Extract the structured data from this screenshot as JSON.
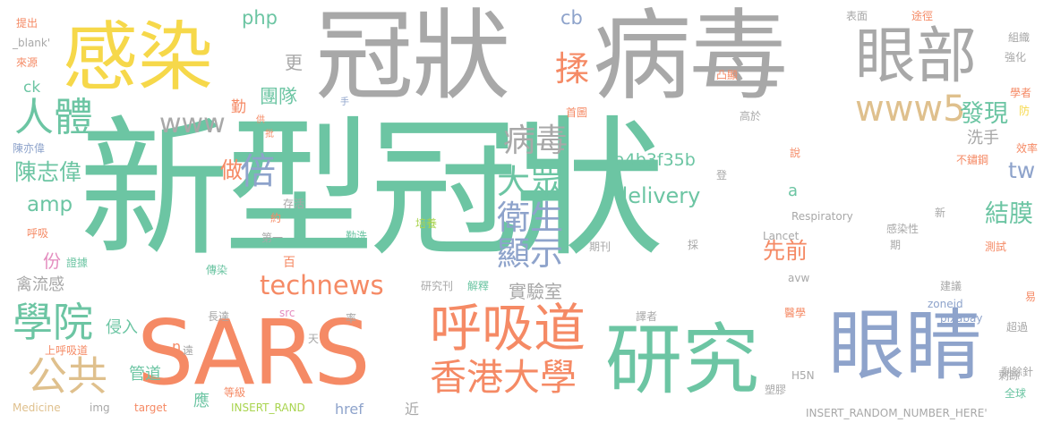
{
  "palette": {
    "green": "#6cc5a3",
    "gray": "#a8a8a8",
    "orange": "#f58a65",
    "blue": "#8ea3cb",
    "yellow": "#f6d84a",
    "pink": "#e48dbf",
    "lime": "#a9d44f",
    "tan": "#dfc08d"
  },
  "words": [
    {
      "text": "新型冠狀",
      "color": "green",
      "size": 160
    },
    {
      "text": "冠狀",
      "color": "gray",
      "size": 108
    },
    {
      "text": "病毒",
      "color": "gray",
      "size": 108
    },
    {
      "text": "感染",
      "color": "yellow",
      "size": 82
    },
    {
      "text": "SARS",
      "color": "orange",
      "size": 96
    },
    {
      "text": "研究",
      "color": "green",
      "size": 84
    },
    {
      "text": "眼睛",
      "color": "blue",
      "size": 84
    },
    {
      "text": "眼部",
      "color": "gray",
      "size": 66
    },
    {
      "text": "呼吸道",
      "color": "orange",
      "size": 56
    },
    {
      "text": "香港大學",
      "color": "orange",
      "size": 40
    },
    {
      "text": "人體",
      "color": "green",
      "size": 42
    },
    {
      "text": "學院",
      "color": "green",
      "size": 44
    },
    {
      "text": "公共",
      "color": "tan",
      "size": 44
    },
    {
      "text": "www5",
      "color": "tan",
      "size": 38
    },
    {
      "text": "www",
      "color": "gray",
      "size": 30
    },
    {
      "text": "technews",
      "color": "orange",
      "size": 28
    },
    {
      "text": "delivery",
      "color": "green",
      "size": 24
    },
    {
      "text": "a4b3f35b",
      "color": "green",
      "size": 19
    },
    {
      "text": "病毒",
      "color": "gray",
      "size": 34
    },
    {
      "text": "大眾",
      "color": "green",
      "size": 36
    },
    {
      "text": "衛生",
      "color": "blue",
      "size": 36
    },
    {
      "text": "顯示",
      "color": "blue",
      "size": 36
    },
    {
      "text": "實驗室",
      "color": "gray",
      "size": 20
    },
    {
      "text": "倍",
      "color": "blue",
      "size": 38
    },
    {
      "text": "揉",
      "color": "orange",
      "size": 36
    },
    {
      "text": "發現",
      "color": "green",
      "size": 26
    },
    {
      "text": "結膜",
      "color": "green",
      "size": 26
    },
    {
      "text": "先前",
      "color": "orange",
      "size": 24
    },
    {
      "text": "tw",
      "color": "blue",
      "size": 24
    },
    {
      "text": "陳志偉",
      "color": "green",
      "size": 24
    },
    {
      "text": "amp",
      "color": "green",
      "size": 22
    },
    {
      "text": "做",
      "color": "orange",
      "size": 24
    },
    {
      "text": "團隊",
      "color": "green",
      "size": 20
    },
    {
      "text": "php",
      "color": "green",
      "size": 20
    },
    {
      "text": "cb",
      "color": "blue",
      "size": 20
    },
    {
      "text": "ck",
      "color": "green",
      "size": 16
    },
    {
      "text": "更",
      "color": "gray",
      "size": 20
    },
    {
      "text": "勤",
      "color": "orange",
      "size": 16
    },
    {
      "text": "份",
      "color": "pink",
      "size": 20
    },
    {
      "text": "禽流感",
      "color": "gray",
      "size": 18
    },
    {
      "text": "侵入",
      "color": "green",
      "size": 18
    },
    {
      "text": "管道",
      "color": "green",
      "size": 18
    },
    {
      "text": "應",
      "color": "green",
      "size": 18
    },
    {
      "text": "洗手",
      "color": "gray",
      "size": 18
    },
    {
      "text": "a",
      "color": "green",
      "size": 18
    },
    {
      "text": "n",
      "color": "orange",
      "size": 16
    },
    {
      "text": "href",
      "color": "blue",
      "size": 16
    },
    {
      "text": "近",
      "color": "gray",
      "size": 16
    },
    {
      "text": "提出",
      "color": "orange",
      "size": 12
    },
    {
      "text": "_blank'",
      "color": "gray",
      "size": 12
    },
    {
      "text": "來源",
      "color": "orange",
      "size": 12
    },
    {
      "text": "手",
      "color": "blue",
      "size": 10
    },
    {
      "text": "陳亦偉",
      "color": "blue",
      "size": 12
    },
    {
      "text": "存活",
      "color": "gray",
      "size": 12
    },
    {
      "text": "約",
      "color": "orange",
      "size": 12
    },
    {
      "text": "呼吸",
      "color": "orange",
      "size": 12
    },
    {
      "text": "第一",
      "color": "gray",
      "size": 12
    },
    {
      "text": "證據",
      "color": "green",
      "size": 12
    },
    {
      "text": "勤洗",
      "color": "green",
      "size": 12
    },
    {
      "text": "傳染",
      "color": "green",
      "size": 12
    },
    {
      "text": "百",
      "color": "orange",
      "size": 14
    },
    {
      "text": "長達",
      "color": "gray",
      "size": 12
    },
    {
      "text": "天",
      "color": "gray",
      "size": 12
    },
    {
      "text": "src",
      "color": "pink",
      "size": 12
    },
    {
      "text": "上呼吸道",
      "color": "orange",
      "size": 12
    },
    {
      "text": "遠",
      "color": "gray",
      "size": 12
    },
    {
      "text": "等級",
      "color": "orange",
      "size": 12
    },
    {
      "text": "Medicine",
      "color": "tan",
      "size": 12
    },
    {
      "text": "img",
      "color": "gray",
      "size": 12
    },
    {
      "text": "target",
      "color": "orange",
      "size": 12
    },
    {
      "text": "INSERT_RAND",
      "color": "lime",
      "size": 12
    },
    {
      "text": "INSERT_RANDOM_NUMBER_HERE'",
      "color": "gray",
      "size": 12
    },
    {
      "text": "表面",
      "color": "gray",
      "size": 12
    },
    {
      "text": "途徑",
      "color": "orange",
      "size": 12
    },
    {
      "text": "組織",
      "color": "gray",
      "size": 12
    },
    {
      "text": "強化",
      "color": "gray",
      "size": 12
    },
    {
      "text": "凸顯",
      "color": "orange",
      "size": 12
    },
    {
      "text": "學者",
      "color": "orange",
      "size": 12
    },
    {
      "text": "防",
      "color": "yellow",
      "size": 12
    },
    {
      "text": "首圖",
      "color": "orange",
      "size": 12
    },
    {
      "text": "高於",
      "color": "gray",
      "size": 12
    },
    {
      "text": "說",
      "color": "orange",
      "size": 12
    },
    {
      "text": "不鏽鋼",
      "color": "orange",
      "size": 12
    },
    {
      "text": "效率",
      "color": "orange",
      "size": 12
    },
    {
      "text": "登",
      "color": "gray",
      "size": 12
    },
    {
      "text": "Respiratory",
      "color": "gray",
      "size": 12
    },
    {
      "text": "新",
      "color": "gray",
      "size": 12
    },
    {
      "text": "感染性",
      "color": "gray",
      "size": 12
    },
    {
      "text": "期",
      "color": "gray",
      "size": 12
    },
    {
      "text": "測試",
      "color": "orange",
      "size": 12
    },
    {
      "text": "期刊",
      "color": "gray",
      "size": 12
    },
    {
      "text": "Lancet",
      "color": "gray",
      "size": 12
    },
    {
      "text": "研究刊",
      "color": "gray",
      "size": 12
    },
    {
      "text": "解釋",
      "color": "green",
      "size": 12
    },
    {
      "text": "avw",
      "color": "gray",
      "size": 12
    },
    {
      "text": "建議",
      "color": "gray",
      "size": 12
    },
    {
      "text": "易",
      "color": "orange",
      "size": 12
    },
    {
      "text": "zoneid",
      "color": "blue",
      "size": 12
    },
    {
      "text": "pixabay",
      "color": "blue",
      "size": 12
    },
    {
      "text": "率",
      "color": "gray",
      "size": 12
    },
    {
      "text": "譯者",
      "color": "gray",
      "size": 12
    },
    {
      "text": "醫學",
      "color": "orange",
      "size": 12
    },
    {
      "text": "超過",
      "color": "gray",
      "size": 12
    },
    {
      "text": "H5N",
      "color": "gray",
      "size": 12
    },
    {
      "text": "剩餘",
      "color": "gray",
      "size": 12
    },
    {
      "text": "塑膠",
      "color": "gray",
      "size": 12
    },
    {
      "text": "剩餘針",
      "color": "gray",
      "size": 12
    },
    {
      "text": "全球",
      "color": "green",
      "size": 12
    },
    {
      "text": "供",
      "color": "orange",
      "size": 10
    },
    {
      "text": "批",
      "color": "orange",
      "size": 10
    },
    {
      "text": "培養",
      "color": "lime",
      "size": 12
    },
    {
      "text": "採",
      "color": "gray",
      "size": 12
    }
  ]
}
